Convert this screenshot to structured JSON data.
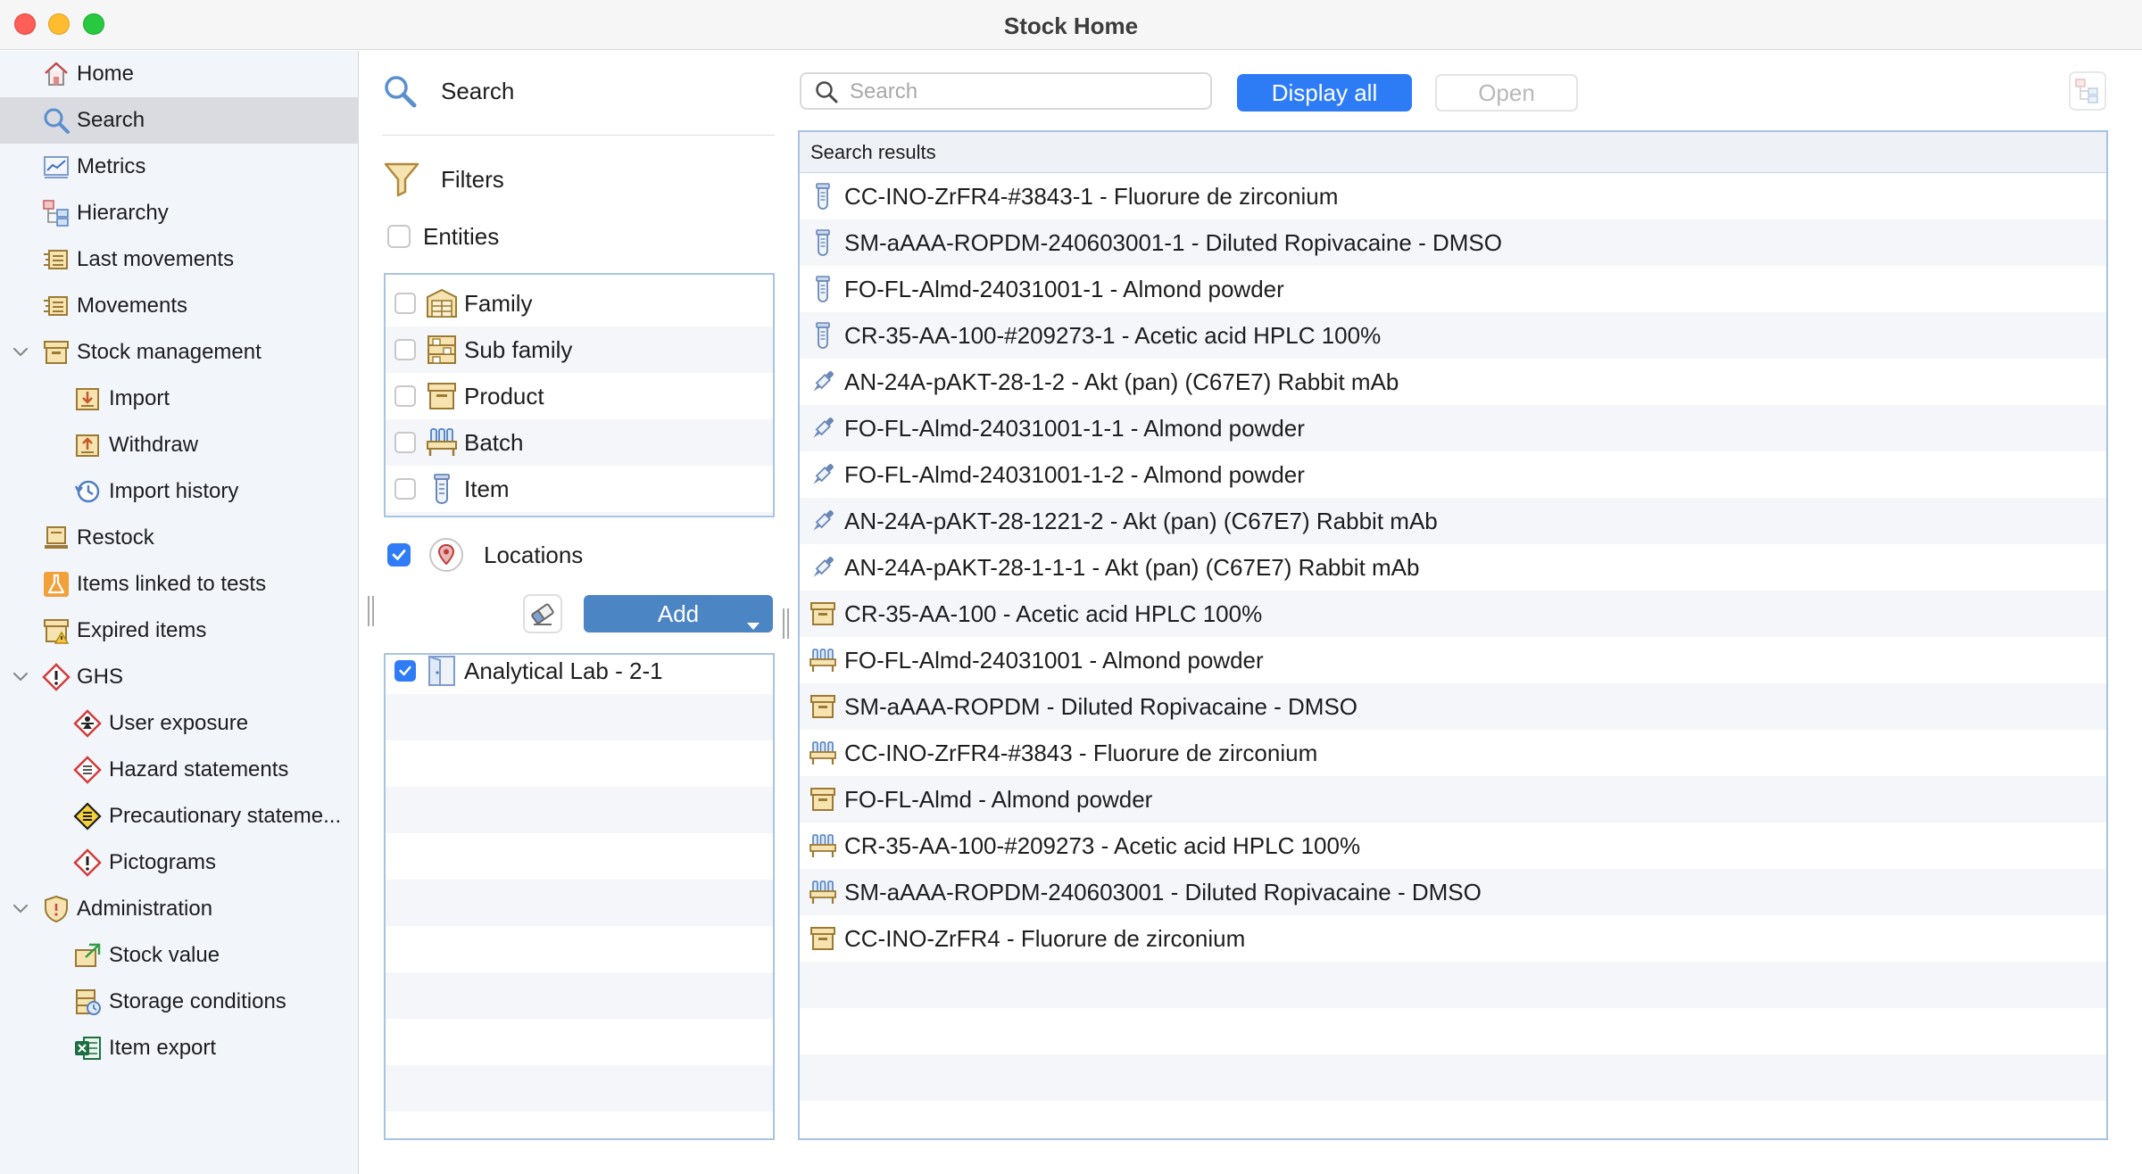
{
  "window": {
    "title": "Stock Home"
  },
  "sidebar": {
    "items": [
      {
        "label": "Home",
        "icon": "home-icon",
        "level": 1
      },
      {
        "label": "Search",
        "icon": "search-icon",
        "level": 1,
        "selected": true
      },
      {
        "label": "Metrics",
        "icon": "metrics-chart-icon",
        "level": 1
      },
      {
        "label": "Hierarchy",
        "icon": "hierarchy-icon",
        "level": 1
      },
      {
        "label": "Last movements",
        "icon": "movements-icon",
        "level": 1
      },
      {
        "label": "Movements",
        "icon": "movements-icon",
        "level": 1
      },
      {
        "label": "Stock management",
        "icon": "box-icon",
        "level": 1,
        "expanded": true
      },
      {
        "label": "Import",
        "icon": "import-icon",
        "level": 2
      },
      {
        "label": "Withdraw",
        "icon": "withdraw-icon",
        "level": 2
      },
      {
        "label": "Import history",
        "icon": "history-icon",
        "level": 2
      },
      {
        "label": "Restock",
        "icon": "restock-icon",
        "level": 1
      },
      {
        "label": "Items linked to tests",
        "icon": "flask-icon",
        "level": 1
      },
      {
        "label": "Expired items",
        "icon": "expired-box-icon",
        "level": 1
      },
      {
        "label": "GHS",
        "icon": "ghs-hazard-icon",
        "level": 1,
        "expanded": true
      },
      {
        "label": "User exposure",
        "icon": "user-exposure-icon",
        "level": 2
      },
      {
        "label": "Hazard statements",
        "icon": "hazard-statement-icon",
        "level": 2
      },
      {
        "label": "Precautionary stateme...",
        "icon": "precaution-icon",
        "level": 2
      },
      {
        "label": "Pictograms",
        "icon": "pictogram-icon",
        "level": 2
      },
      {
        "label": "Administration",
        "icon": "shield-icon",
        "level": 1,
        "expanded": true
      },
      {
        "label": "Stock value",
        "icon": "stock-value-icon",
        "level": 2
      },
      {
        "label": "Storage conditions",
        "icon": "storage-conditions-icon",
        "level": 2
      },
      {
        "label": "Item export",
        "icon": "excel-icon",
        "level": 2
      }
    ]
  },
  "filters": {
    "search_label": "Search",
    "filters_label": "Filters",
    "entities_label": "Entities",
    "entities": [
      {
        "label": "Family",
        "icon": "family-icon",
        "checked": false
      },
      {
        "label": "Sub family",
        "icon": "sub-family-icon",
        "checked": false
      },
      {
        "label": "Product",
        "icon": "product-icon",
        "checked": false
      },
      {
        "label": "Batch",
        "icon": "batch-icon",
        "checked": false
      },
      {
        "label": "Item",
        "icon": "item-tube-icon",
        "checked": false
      }
    ],
    "locations_label": "Locations",
    "locations_checked": true,
    "add_label": "Add",
    "locations": [
      {
        "label": "Analytical Lab - 2-1",
        "icon": "door-icon",
        "checked": true
      }
    ]
  },
  "toolbar": {
    "search_placeholder": "Search",
    "search_value": "",
    "display_all_label": "Display all",
    "open_label": "Open"
  },
  "results": {
    "header": "Search results",
    "rows": [
      {
        "label": "CC-INO-ZrFR4-#3843-1 - Fluorure de zirconium",
        "icon": "tube-icon"
      },
      {
        "label": "SM-aAAA-ROPDM-240603001-1 - Diluted Ropivacaine - DMSO",
        "icon": "tube-icon"
      },
      {
        "label": "FO-FL-Almd-24031001-1 - Almond powder",
        "icon": "tube-icon"
      },
      {
        "label": "CR-35-AA-100-#209273-1 - Acetic acid HPLC 100%",
        "icon": "tube-icon"
      },
      {
        "label": "AN-24A-pAKT-28-1-2 - Akt (pan) (C67E7) Rabbit mAb",
        "icon": "pipette-icon"
      },
      {
        "label": "FO-FL-Almd-24031001-1-1 - Almond powder",
        "icon": "pipette-icon"
      },
      {
        "label": "FO-FL-Almd-24031001-1-2 - Almond powder",
        "icon": "pipette-icon"
      },
      {
        "label": "AN-24A-pAKT-28-1221-2 - Akt (pan) (C67E7) Rabbit mAb",
        "icon": "pipette-icon"
      },
      {
        "label": "AN-24A-pAKT-28-1-1-1 - Akt (pan) (C67E7) Rabbit mAb",
        "icon": "pipette-icon"
      },
      {
        "label": "CR-35-AA-100 - Acetic acid HPLC 100%",
        "icon": "product-box-icon"
      },
      {
        "label": "FO-FL-Almd-24031001 - Almond powder",
        "icon": "batch-rack-icon"
      },
      {
        "label": "SM-aAAA-ROPDM - Diluted Ropivacaine - DMSO",
        "icon": "product-box-icon"
      },
      {
        "label": "CC-INO-ZrFR4-#3843 - Fluorure de zirconium",
        "icon": "batch-rack-icon"
      },
      {
        "label": "FO-FL-Almd - Almond powder",
        "icon": "product-box-icon"
      },
      {
        "label": "CR-35-AA-100-#209273 - Acetic acid HPLC 100%",
        "icon": "batch-rack-icon"
      },
      {
        "label": "SM-aAAA-ROPDM-240603001 - Diluted Ropivacaine - DMSO",
        "icon": "batch-rack-icon"
      },
      {
        "label": "CC-INO-ZrFR4 - Fluorure de zirconium",
        "icon": "product-box-icon"
      }
    ]
  },
  "colors": {
    "accent": "#2d7cf6",
    "add_button": "#4c85c4",
    "list_border": "#a9c3e2",
    "selected_row": "#d9dbe0"
  }
}
